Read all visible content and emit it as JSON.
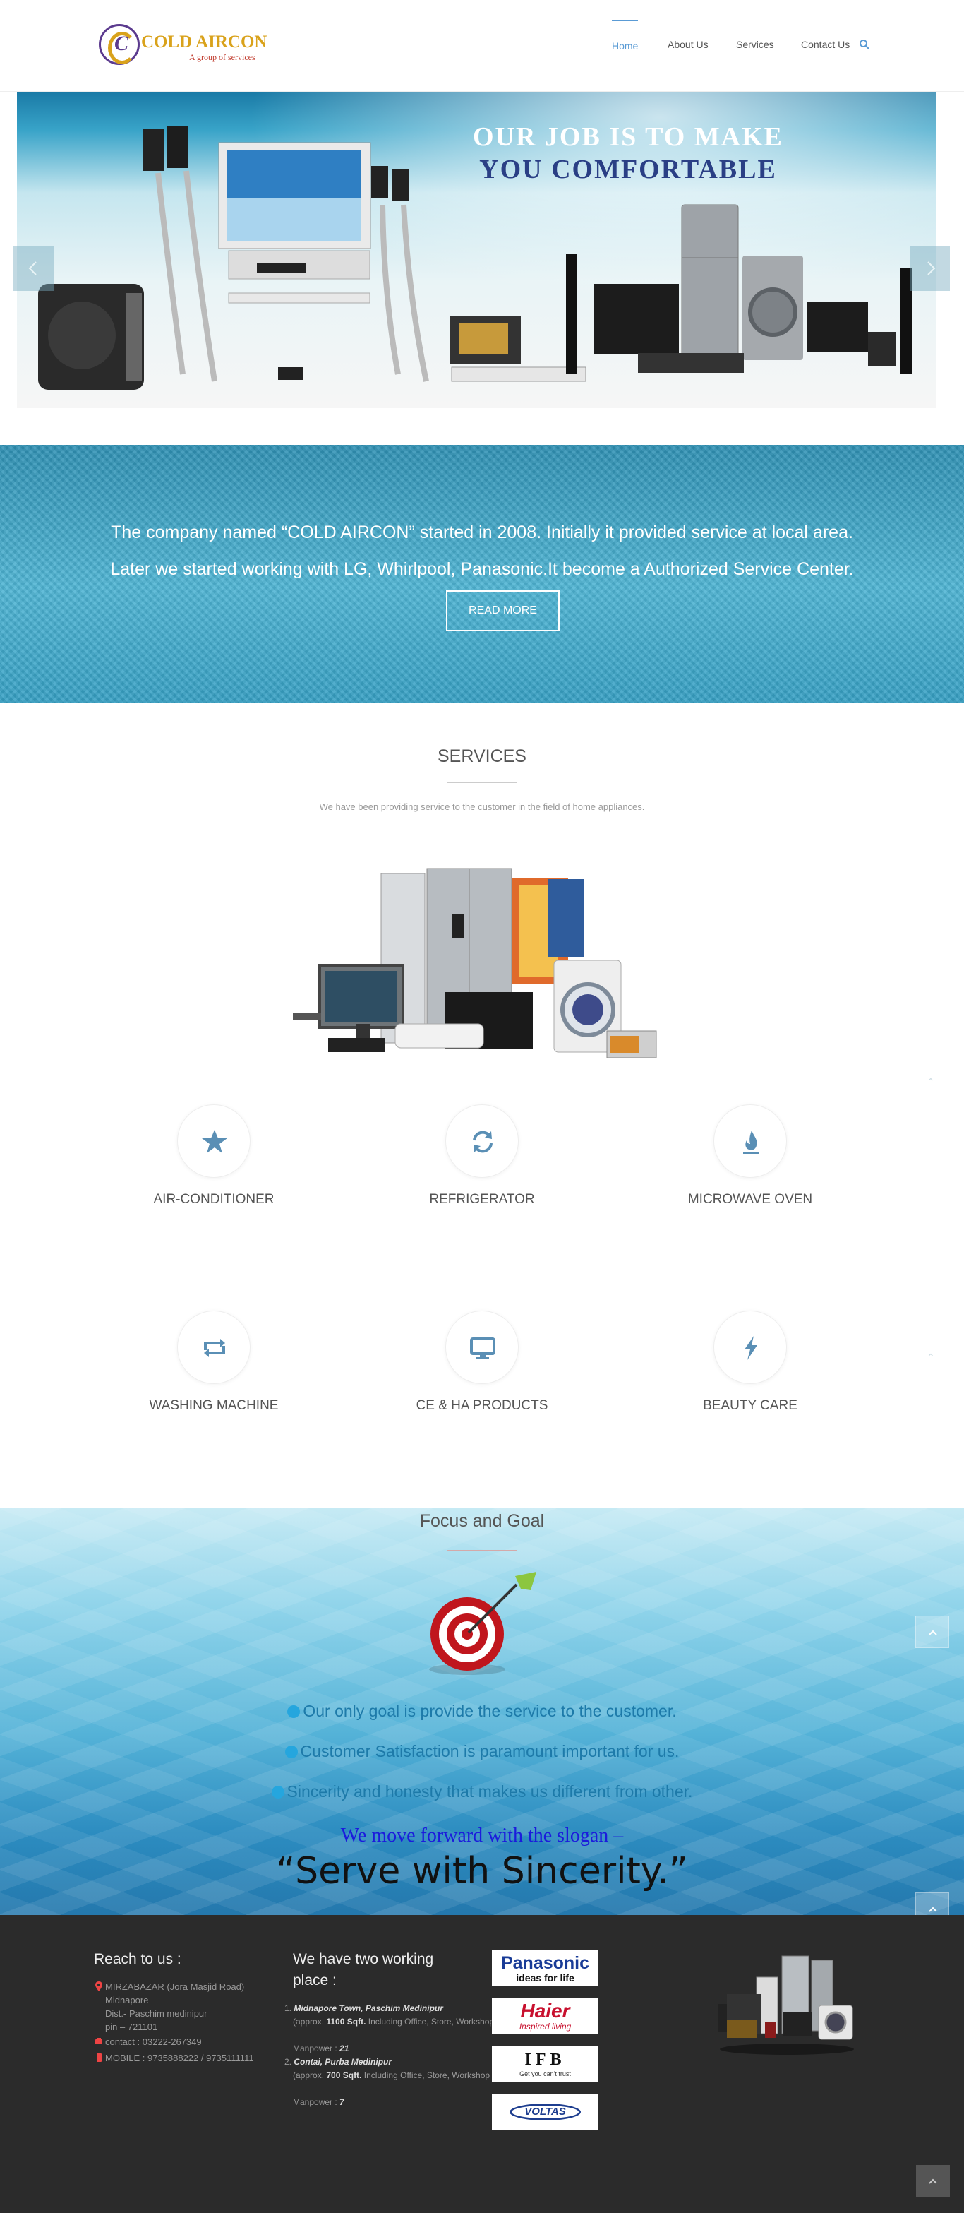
{
  "header": {
    "logo_name": "COLD AIRCON",
    "logo_tagline": "A group of services",
    "nav": [
      "Home",
      "About Us",
      "Services",
      "Contact Us"
    ],
    "active_nav": "Home",
    "accent": "#5a9bd5"
  },
  "slider": {
    "headline_1": "OUR JOB IS TO MAKE",
    "headline_2": "YOU COMFORTABLE"
  },
  "banner": {
    "line_1": "The company named “COLD AIRCON” started in 2008. Initially it provided service at local area.",
    "line_2": "Later we started working with LG, Whirlpool, Panasonic.It become a Authorized Service Center.",
    "button": "READ MORE"
  },
  "services": {
    "title": "SERVICES",
    "subtitle": "We have been providing service to the customer in the field of home appliances.",
    "items": [
      {
        "label": "AIR-CONDITIONER",
        "icon": "star-icon"
      },
      {
        "label": "REFRIGERATOR",
        "icon": "refresh-icon"
      },
      {
        "label": "MICROWAVE OVEN",
        "icon": "fire-icon"
      },
      {
        "label": "WASHING MACHINE",
        "icon": "retweet-icon"
      },
      {
        "label": "CE & HA PRODUCTS",
        "icon": "monitor-icon"
      },
      {
        "label": "BEAUTY CARE",
        "icon": "bolt-icon"
      }
    ],
    "icon_color": "#5a8fb5"
  },
  "focus": {
    "title": "Focus and Goal",
    "goals": [
      "Our only goal is provide the service to the customer.",
      "Customer Satisfaction is paramount important for us.",
      "Sincerity and honesty that makes us different from other."
    ],
    "slogan_intro": "We move forward with the slogan –",
    "slogan": "“Serve with Sincerity.”"
  },
  "footer": {
    "reach_title": "Reach to us :",
    "address": [
      "MIRZABAZAR (Jora Masjid Road)",
      "Midnapore",
      "Dist.- Paschim medinipur",
      "pin – 721101"
    ],
    "contact": "contact : 03222-267349",
    "mobile": "MOBILE : 9735888222 / 9735111111",
    "places_title": "We have two working place :",
    "place_1": {
      "num": "1.",
      "name": "Midnapore Town, Paschim Medinipur",
      "approx_pre": "(approx.",
      "area": "1100 Sqft.",
      "approx_post": "Including Office, Store, Workshop )",
      "manpower_label": "Manpower :",
      "manpower": "21"
    },
    "place_2": {
      "num": "2.",
      "name": "Contai, Purba Medinipur",
      "approx_pre": "(approx.",
      "area": "700 Sqft.",
      "approx_post": "Including Office, Store, Workshop )",
      "manpower_label": "Manpower :",
      "manpower": "7"
    },
    "brands": [
      {
        "name": "Panasonic",
        "tagline": "ideas for life"
      },
      {
        "name": "Haier",
        "tagline": "Inspired living"
      },
      {
        "name": "IFB",
        "tagline": "Get you can't trust"
      },
      {
        "name": "VOLTAS",
        "tagline": ""
      }
    ]
  }
}
